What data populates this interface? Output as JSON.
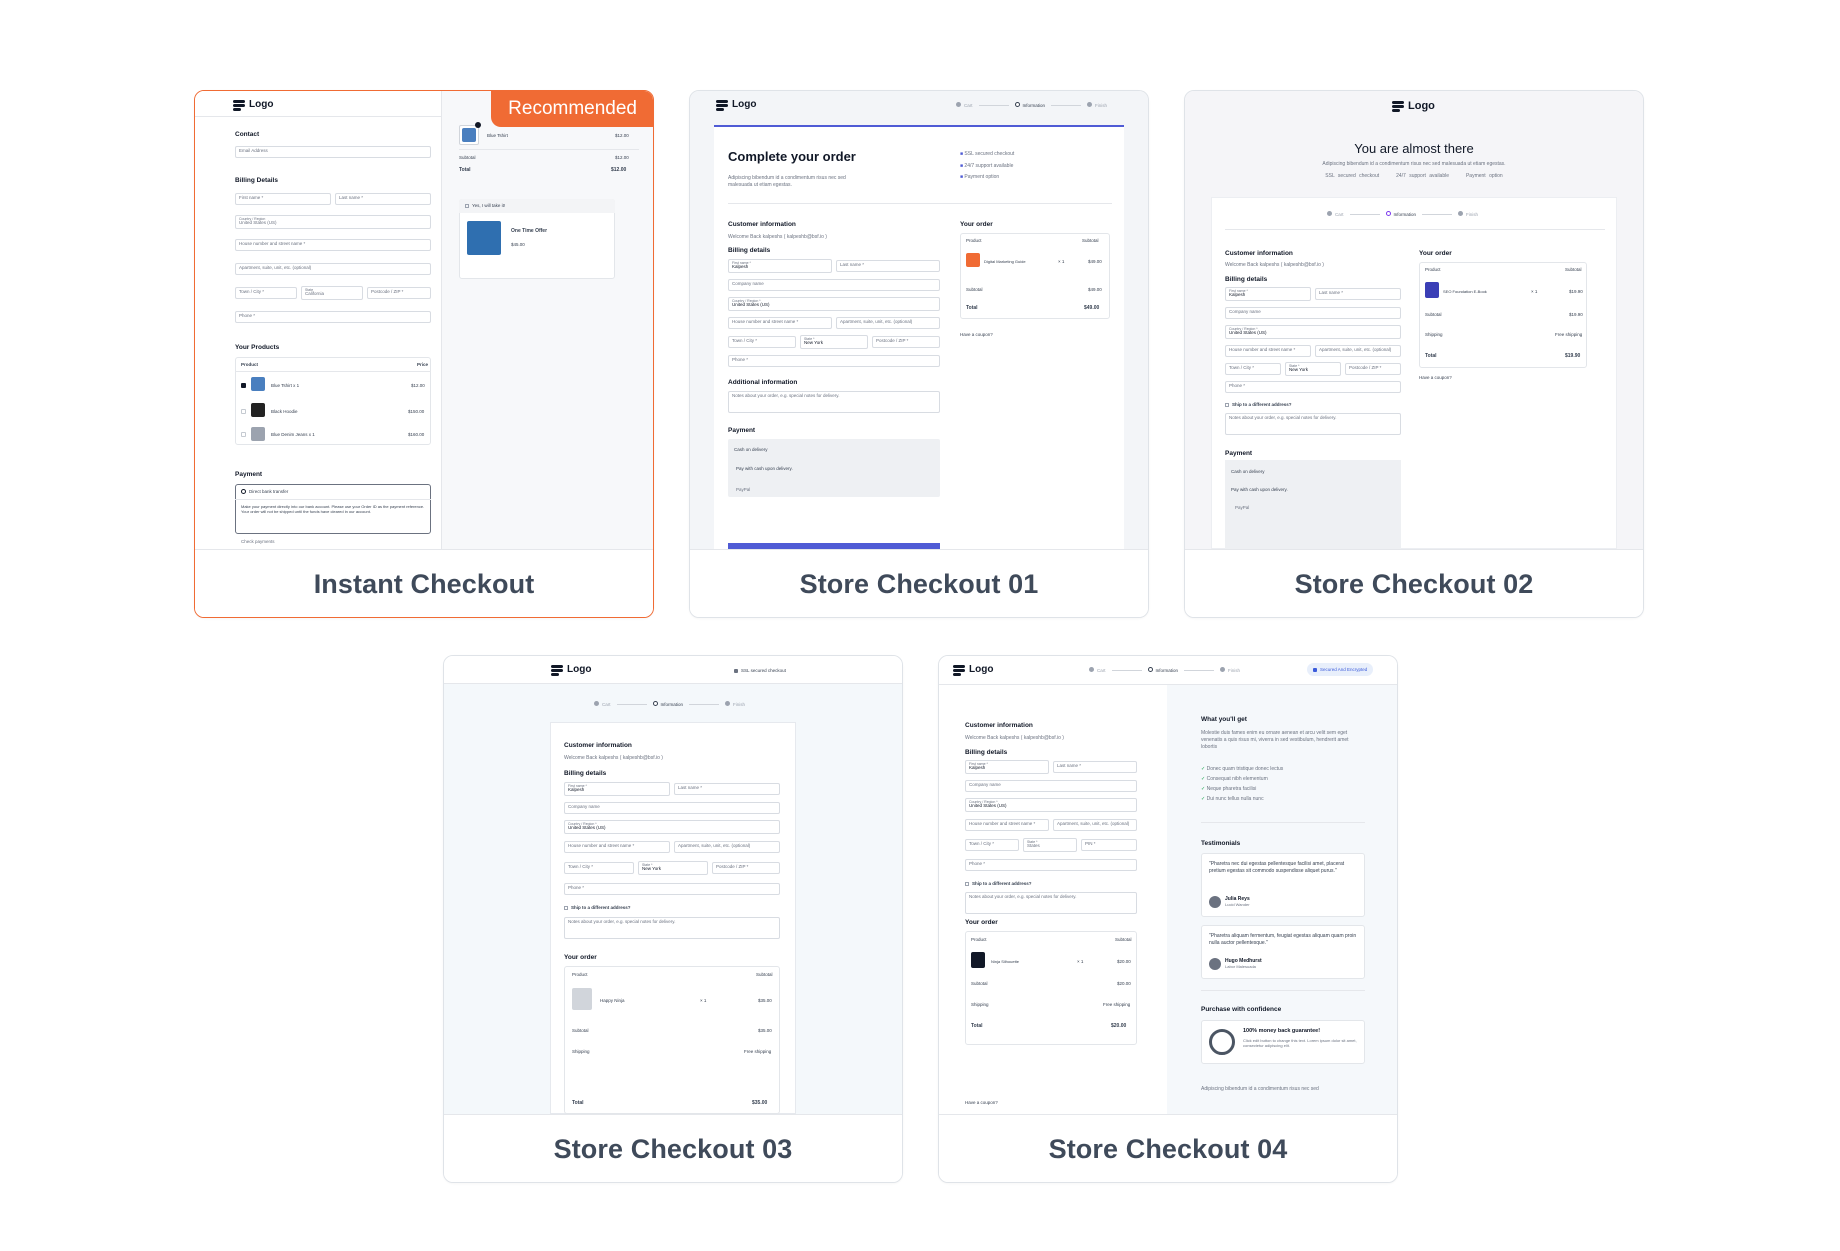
{
  "cards": [
    {
      "title": "Instant Checkout",
      "badge": "Recommended",
      "preview": {
        "logo": "Logo",
        "contact": "Contact",
        "email": "Email Address",
        "billing": "Billing Details",
        "first_name": "First name *",
        "last_name": "Last name *",
        "country_label": "Country / Region",
        "country": "United States (US)",
        "house": "House number and street name *",
        "apartment": "Apartment, suite, unit, etc. (optional)",
        "town": "Town / City *",
        "state_label": "State",
        "state": "California",
        "postcode": "Postcode / ZIP *",
        "phone": "Phone *",
        "your_products": "Your Products",
        "col_product": "Product",
        "col_price": "Price",
        "products": [
          {
            "name": "Blue Tshirt x 1",
            "price": "$12.00"
          },
          {
            "name": "Black Hoodie",
            "price": "$150.00"
          },
          {
            "name": "Blue Denim Jeans x 1",
            "price": "$160.00"
          }
        ],
        "payment": "Payment",
        "direct_bank": "Direct bank transfer",
        "bank_note": "Make your payment directly into our bank account. Please use your Order ID as the payment reference. Your order will not be shipped until the funds have cleared in our account.",
        "check": "Check payments",
        "summary_item": "Blue Tshirt",
        "summary_item_price": "$12.00",
        "subtotal": "Subtotal",
        "subtotal_value": "$12.00",
        "total": "Total",
        "total_value": "$12.00",
        "offer_check": "Yes, I will take it!",
        "offer_title": "One Time Offer",
        "offer_price": "$45.00"
      }
    },
    {
      "title": "Store Checkout 01",
      "preview": {
        "logo": "Logo",
        "steps": [
          "Cart",
          "Information",
          "Finish"
        ],
        "heading": "Complete your order",
        "sub": "Adipiscing bibendum id a condimentum risus nec sed malesuada ut etiam egestas.",
        "features": [
          "SSL secured checkout",
          "24/7 support available",
          "Payment option"
        ],
        "customer_info": "Customer information",
        "welcome": "Welcome Back kalpeshs ( kalpeshb@bsf.io )",
        "billing": "Billing details",
        "first_name_label": "First name *",
        "first_name": "Kalpesh",
        "last_name": "Last name *",
        "company": "Company name",
        "country_label": "Country / Region *",
        "country": "United States (US)",
        "house": "House number and street name *",
        "apartment": "Apartment, suite, unit, etc. (optional)",
        "town": "Town / City *",
        "state_label": "State *",
        "state": "New York",
        "postcode": "Postcode / ZIP *",
        "phone": "Phone *",
        "additional": "Additional information",
        "notes": "Notes about your order, e.g. special notes for delivery.",
        "payment": "Payment",
        "cod": "Cash on delivery",
        "cod_note": "Pay with cash upon delivery.",
        "paypal": "PayPal",
        "your_order": "Your order",
        "col_product": "Product",
        "col_subtotal": "Subtotal",
        "item": "Digital Marketing Guide",
        "qty": "× 1",
        "item_price": "$49.00",
        "subtotal": "Subtotal",
        "subtotal_value": "$49.00",
        "total": "Total",
        "total_value": "$49.00",
        "coupon": "Have a coupon?"
      }
    },
    {
      "title": "Store Checkout 02",
      "preview": {
        "logo": "Logo",
        "heading": "You are almost there",
        "sub": "Adipiscing bibendum id a condimentum risus nec sed malesuada ut etiam egestas.",
        "features": [
          "SSL secured checkout",
          "24/7 support available",
          "Payment option"
        ],
        "steps": [
          "Cart",
          "Information",
          "Finish"
        ],
        "customer_info": "Customer information",
        "welcome": "Welcome Back kalpeshs ( kalpeshb@bsf.io )",
        "billing": "Billing details",
        "first_name_label": "First name *",
        "first_name": "Kalpesh",
        "last_name": "Last name *",
        "company": "Company name",
        "country_label": "Country / Region *",
        "country": "United States (US)",
        "house": "House number and street name *",
        "apartment": "Apartment, suite, unit, etc. (optional)",
        "town": "Town / City *",
        "state_label": "State *",
        "state": "New York",
        "postcode": "Postcode / ZIP *",
        "phone": "Phone *",
        "ship_diff": "Ship to a different address?",
        "notes": "Notes about your order, e.g. special notes for delivery.",
        "payment": "Payment",
        "cod": "Cash on delivery",
        "cod_note": "Pay with cash upon delivery.",
        "paypal": "PayPal",
        "your_order": "Your order",
        "col_product": "Product",
        "col_subtotal": "Subtotal",
        "item": "SEO Foundation E-Book",
        "qty": "× 1",
        "item_price": "$19.90",
        "subtotal": "Subtotal",
        "subtotal_value": "$19.90",
        "shipping": "Shipping",
        "shipping_value": "Free shipping",
        "total": "Total",
        "total_value": "$19.90",
        "coupon": "Have a coupon?"
      }
    },
    {
      "title": "Store Checkout 03",
      "preview": {
        "logo": "Logo",
        "secure": "SSL secured checkout",
        "steps": [
          "Cart",
          "Information",
          "Finish"
        ],
        "customer_info": "Customer information",
        "welcome": "Welcome Back kalpeshs ( kalpeshb@bsf.io )",
        "billing": "Billing details",
        "first_name_label": "First name *",
        "first_name": "Kalpesh",
        "last_name": "Last name *",
        "company": "Company name",
        "country_label": "Country / Region *",
        "country": "United States (US)",
        "house": "House number and street name *",
        "apartment": "Apartment, suite, unit, etc. (optional)",
        "town": "Town / City *",
        "state_label": "State *",
        "state": "New York",
        "postcode": "Postcode / ZIP *",
        "phone": "Phone *",
        "ship_diff": "Ship to a different address?",
        "notes": "Notes about your order, e.g. special notes for delivery.",
        "your_order": "Your order",
        "col_product": "Product",
        "col_subtotal": "Subtotal",
        "item": "Happy Ninja",
        "qty": "× 1",
        "item_price": "$35.00",
        "subtotal": "Subtotal",
        "subtotal_value": "$35.00",
        "shipping": "Shipping",
        "shipping_value": "Free shipping",
        "total": "Total",
        "total_value": "$35.00"
      }
    },
    {
      "title": "Store Checkout 04",
      "preview": {
        "logo": "Logo",
        "steps": [
          "Cart",
          "Information",
          "Finish"
        ],
        "secure": "Secured And Encrypted",
        "customer_info": "Customer information",
        "welcome": "Welcome Back kalpeshs ( kalpeshb@bsf.io )",
        "billing": "Billing details",
        "first_name_label": "First name *",
        "first_name": "Kalpesh",
        "last_name": "Last name *",
        "company": "Company name",
        "country_label": "Country / Region *",
        "country": "United States (US)",
        "house": "House number and street name *",
        "apartment": "Apartment, suite, unit, etc. (optional)",
        "town": "Town / City *",
        "state_label": "State *",
        "state": "States",
        "postcode": "PIN *",
        "phone": "Phone *",
        "ship_diff": "Ship to a different address?",
        "notes": "Notes about your order, e.g. special notes for delivery.",
        "your_order": "Your order",
        "col_product": "Product",
        "col_subtotal": "Subtotal",
        "item": "Ninja Silhouette",
        "qty": "× 1",
        "item_price": "$20.00",
        "subtotal": "Subtotal",
        "subtotal_value": "$20.00",
        "shipping": "Shipping",
        "shipping_value": "Free shipping",
        "total": "Total",
        "total_value": "$20.00",
        "coupon": "Have a coupon?",
        "get_title": "What you'll get",
        "get_text": "Molestie duis fames enim eu ornare aenean et arcu velit sem eget venenatis a quis risus mi, viverra in sed vestibulum, hendrerit amet lobortis",
        "get_items": [
          "Donec quam tristique donec lectus",
          "Consequat nibh elementum",
          "Neque pharetra facilisi",
          "Dui nunc tellus nulla nunc"
        ],
        "testimonials": "Testimonials",
        "t1_quote": "\"Pharetra nec dui egestas pellentesque facilisi amet, placerat pretium egestas sit commodo suspendisse aliquet purus.\"",
        "t1_name": "Julia Reys",
        "t1_role": "Lucid Wander",
        "t2_quote": "\"Pharetra aliquam fermentum, feugiat egestas aliquam quam proin nulla auctor pellentesque.\"",
        "t2_name": "Hugo Medhurst",
        "t2_role": "Labor Malesuada",
        "confidence": "Purchase with confidence",
        "guarantee": "100% money back guarantee!",
        "guarantee_text": "Click edit button to change this text. Lorem ipsum dolor sit amet, consectetur adipiscing elit.",
        "footer_text": "Adipiscing bibendum id a condimentum risus nec sed"
      }
    }
  ]
}
